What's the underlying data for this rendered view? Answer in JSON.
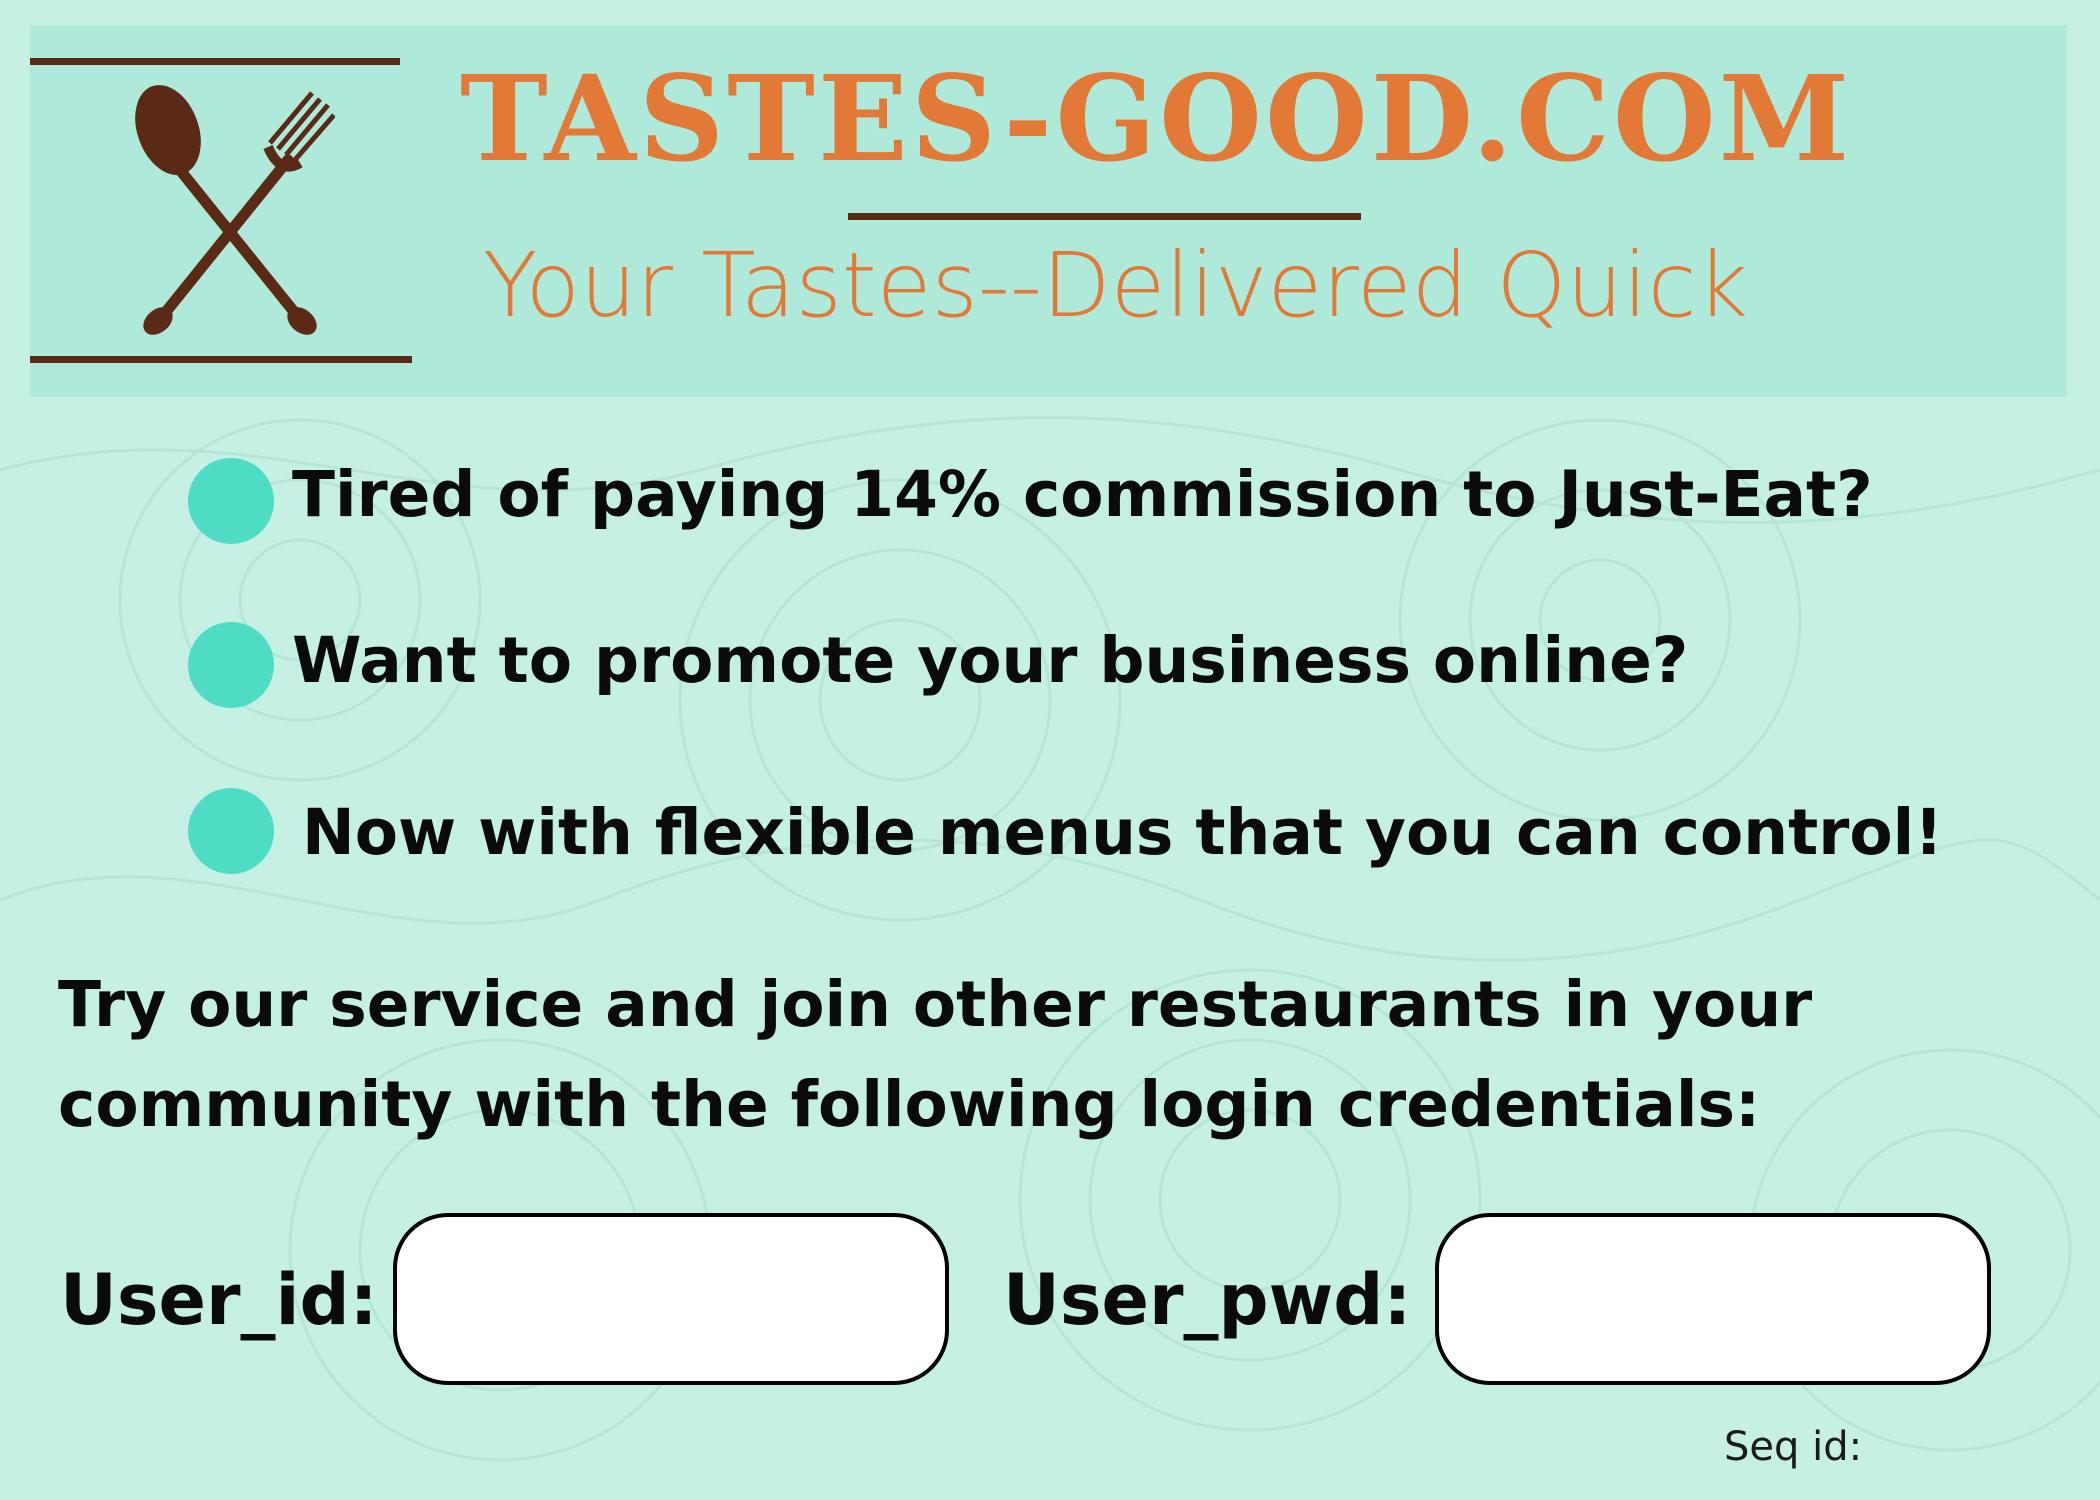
{
  "brand": {
    "name": "TASTES-GOOD.COM",
    "tagline": "Your Tastes--Delivered Quick",
    "logo_icon": "spoon-fork-crossed-icon"
  },
  "bullets": [
    "Tired of paying 14% commission to Just-Eat?",
    "Want to promote your business online?",
    "Now with flexible menus that you can control!"
  ],
  "cta": {
    "line1": "Try our service and join other restaurants in your",
    "line2": "community with the following login credentials:"
  },
  "form": {
    "user_id_label": "User_id:",
    "user_id_value": "",
    "user_pwd_label": "User_pwd:",
    "user_pwd_value": ""
  },
  "footer": {
    "seq_label": "Seq id:"
  },
  "colors": {
    "background": "#c6f0e4",
    "banner": "#aee9d9",
    "brand_orange": "#e37937",
    "brown": "#5a2a16",
    "bullet_dot": "#4fdcc4"
  }
}
